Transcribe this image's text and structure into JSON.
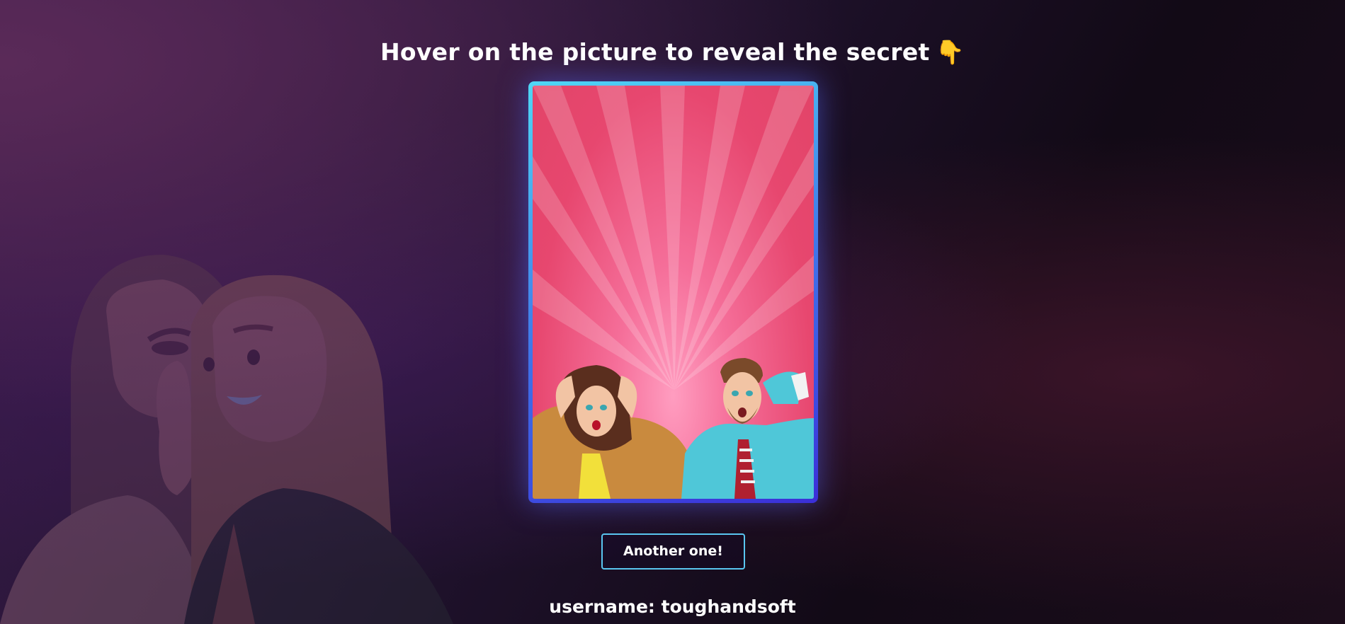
{
  "page": {
    "title": "Hover on the picture to reveal the secret",
    "title_emoji": "👇",
    "image_alt": "Two surprised people holding their heads on a pink sunburst background",
    "button_label": "Another one!",
    "username_label": "username:",
    "username_value": "toughandsoft",
    "username_text": "username: toughandsoft"
  },
  "colors": {
    "card_border_start": "#4fd8f5",
    "card_border_end": "#3b2fd8",
    "card_background": "#e7476f",
    "button_border": "#59c6f0",
    "text": "#ffffff"
  }
}
